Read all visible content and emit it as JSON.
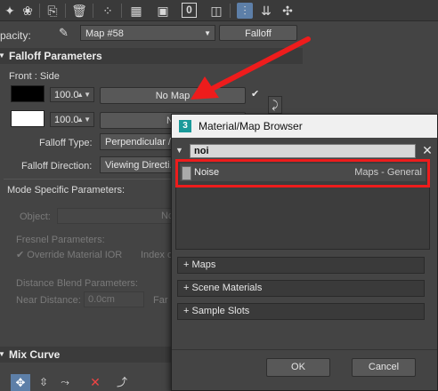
{
  "toolbar": {
    "icons": [
      "render-icon",
      "sphere-icon",
      "eyedropper-icon",
      "trash-icon",
      "scatter-icon",
      "checker-icon",
      "save-icon",
      "zero-icon",
      "frame-icon",
      "material-toggle-icon",
      "nav-down-icon",
      "sample-icon"
    ],
    "active_index": 9
  },
  "opacity_row": {
    "label": "pacity:",
    "map_name": "Map #58",
    "type_button": "Falloff"
  },
  "falloff_params": {
    "header": "Falloff Parameters",
    "front_side_label": "Front : Side",
    "row1": {
      "swatch_color": "#000000",
      "value": "100.0",
      "map_button": "No Map"
    },
    "row2": {
      "swatch_color": "#ffffff",
      "value": "100.0",
      "map_button": "No"
    },
    "falloff_type_label": "Falloff Type:",
    "falloff_type_value": "Perpendicular /",
    "falloff_direction_label": "Falloff Direction:",
    "falloff_direction_value": "Viewing Directi..."
  },
  "mode_specific": {
    "header": "Mode Specific Parameters:",
    "object_label": "Object:",
    "object_value": "No",
    "fresnel_label": "Fresnel Parameters:",
    "override_ior_label": "Override Material IOR",
    "index_label": "Index o",
    "distance_blend_label": "Distance Blend Parameters:",
    "near_distance_label": "Near Distance:",
    "near_distance_value": "0.0cm",
    "far_label": "Far C"
  },
  "mix_curve": {
    "header": "Mix Curve"
  },
  "browser": {
    "title": "Material/Map Browser",
    "title_badge": "3",
    "search_value": "noi",
    "result_name": "Noise",
    "result_category": "Maps - General",
    "categories": [
      "+ Maps",
      "+ Scene Materials",
      "+ Sample Slots"
    ],
    "ok_label": "OK",
    "cancel_label": "Cancel"
  },
  "annotation": {
    "color": "#ee1c1c"
  }
}
